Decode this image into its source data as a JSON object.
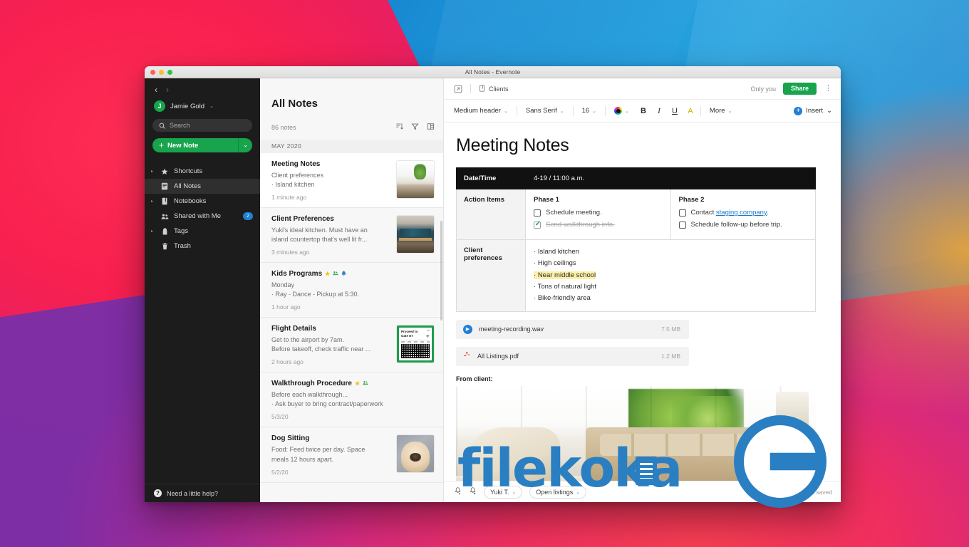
{
  "window": {
    "title": "All Notes - Evernote",
    "traffic_lights": [
      "close",
      "minimize",
      "zoom"
    ]
  },
  "sidebar": {
    "nav_back": "‹",
    "nav_forward": "›",
    "account": {
      "initial": "J",
      "name": "Jamie Gold",
      "caret": "⌄"
    },
    "search": {
      "placeholder": "Search",
      "icon": "search-icon"
    },
    "new_note": {
      "label": "New Note",
      "plus": "+",
      "caret": "⌄"
    },
    "items": [
      {
        "label": "Shortcuts",
        "icon": "star-icon",
        "twisty": true,
        "badge": "",
        "active": false
      },
      {
        "label": "All Notes",
        "icon": "notes-icon",
        "twisty": false,
        "badge": "",
        "active": true
      },
      {
        "label": "Notebooks",
        "icon": "notebook-icon",
        "twisty": true,
        "badge": "",
        "active": false
      },
      {
        "label": "Shared with Me",
        "icon": "people-icon",
        "twisty": false,
        "badge": "2",
        "active": false
      },
      {
        "label": "Tags",
        "icon": "tag-icon",
        "twisty": true,
        "badge": "",
        "active": false
      },
      {
        "label": "Trash",
        "icon": "trash-icon",
        "twisty": false,
        "badge": "",
        "active": false
      }
    ],
    "help": {
      "label": "Need a little help?",
      "icon": "question-icon"
    }
  },
  "notelist": {
    "title": "All Notes",
    "count_label": "86 notes",
    "tools": [
      {
        "name": "sort-icon",
        "glyph": "⇟"
      },
      {
        "name": "filter-icon",
        "glyph": "▽"
      },
      {
        "name": "view-icon",
        "glyph": "▤"
      }
    ],
    "month_header": "MAY 2020",
    "notes": [
      {
        "title": "Meeting Notes",
        "tags": [],
        "lines": [
          "Client preferences",
          "· Island kitchen"
        ],
        "date": "1 minute ago",
        "thumb": "living-room",
        "selected": true
      },
      {
        "title": "Client Preferences",
        "tags": [],
        "lines": [
          "Yuki's ideal kitchen. Must have an",
          "island countertop that's well lit fr..."
        ],
        "date": "3 minutes ago",
        "thumb": "kitchen",
        "selected": false
      },
      {
        "title": "Kids Programs",
        "tags": [
          "★",
          "👥",
          "🔔"
        ],
        "lines": [
          "Monday",
          "· Ray - Dance - Pickup at 5:30."
        ],
        "date": "1 hour ago",
        "thumb": "",
        "selected": false
      },
      {
        "title": "Flight Details",
        "tags": [],
        "lines": [
          "Get to the airport by 7am.",
          "Before takeoff, check traffic near ..."
        ],
        "date": "2 hours ago",
        "thumb": "boarding-pass",
        "selected": false
      },
      {
        "title": "Walkthrough Procedure",
        "tags": [
          "★",
          "👥"
        ],
        "lines": [
          "Before each walkthrough...",
          "·  Ask buyer to bring contract/paperwork"
        ],
        "date": "5/3/20",
        "thumb": "",
        "selected": false
      },
      {
        "title": "Dog Sitting",
        "tags": [],
        "lines": [
          "Food: Feed twice per day. Space",
          "meals 12 hours apart."
        ],
        "date": "5/2/20",
        "thumb": "dog",
        "selected": false
      }
    ],
    "boarding_pass": {
      "line1": "Proceed to",
      "line2": "Gate E7",
      "corner": "2A"
    }
  },
  "editor": {
    "topbar": {
      "expand_icon": "expand-note-icon",
      "notebook": "Clients",
      "notebook_icon": "notebook-icon",
      "only_you": "Only you",
      "share_label": "Share",
      "kebab": "⋮"
    },
    "format_bar": {
      "style": "Medium header",
      "font": "Sans Serif",
      "size": "16",
      "bold": "B",
      "italic": "I",
      "underline": "U",
      "highlight": "A",
      "more": "More",
      "insert": "Insert",
      "caret": "⌄"
    },
    "note": {
      "heading": "Meeting Notes",
      "table": {
        "row_datetime": {
          "label": "Date/Time",
          "value": "4-19 / 11:00 a.m."
        },
        "row_actions": {
          "label": "Action Items",
          "phase1": {
            "title": "Phase 1",
            "items": [
              {
                "text": "Schedule meeting.",
                "checked": false
              },
              {
                "text": "Send walkthrough info.",
                "checked": true
              }
            ]
          },
          "phase2": {
            "title": "Phase 2",
            "items": [
              {
                "text": "Contact ",
                "link": "staging company",
                "suffix": ".",
                "checked": false
              },
              {
                "text": "Schedule follow-up before trip.",
                "checked": false
              }
            ]
          }
        },
        "row_prefs": {
          "label": "Client preferences",
          "items": [
            {
              "text": "Island kitchen",
              "highlight": false
            },
            {
              "text": "High ceilings",
              "highlight": false
            },
            {
              "text": "Near middle school",
              "highlight": true
            },
            {
              "text": "Tons of natural light",
              "highlight": false
            },
            {
              "text": "Bike-friendly area",
              "highlight": false
            }
          ]
        }
      },
      "attachments": [
        {
          "name": "meeting-recording.wav",
          "size": "7.5 MB",
          "icon": "play-icon"
        },
        {
          "name": "All Listings.pdf",
          "size": "1.2 MB",
          "icon": "pdf-icon"
        }
      ],
      "image_caption": "From client:",
      "image_alt": "living-room-photo"
    },
    "bottombar": {
      "reminder_icon": "bell-add-icon",
      "share_icon": "bell-share-icon",
      "author_chip": "Yuki T.",
      "tag_chip": "Open listings",
      "saved_text": "All changes saved",
      "caret": "⌄"
    }
  },
  "watermark": {
    "text": "filekoka",
    "color": "#2a7fc2"
  },
  "colors": {
    "evernote_green": "#17a44c",
    "accent_blue": "#1f7fd6",
    "sidebar_bg": "#1c1c1c",
    "list_bg": "#f7f7f7",
    "highlight_yellow": "#fbf0a8",
    "link_blue": "#1878c8"
  }
}
